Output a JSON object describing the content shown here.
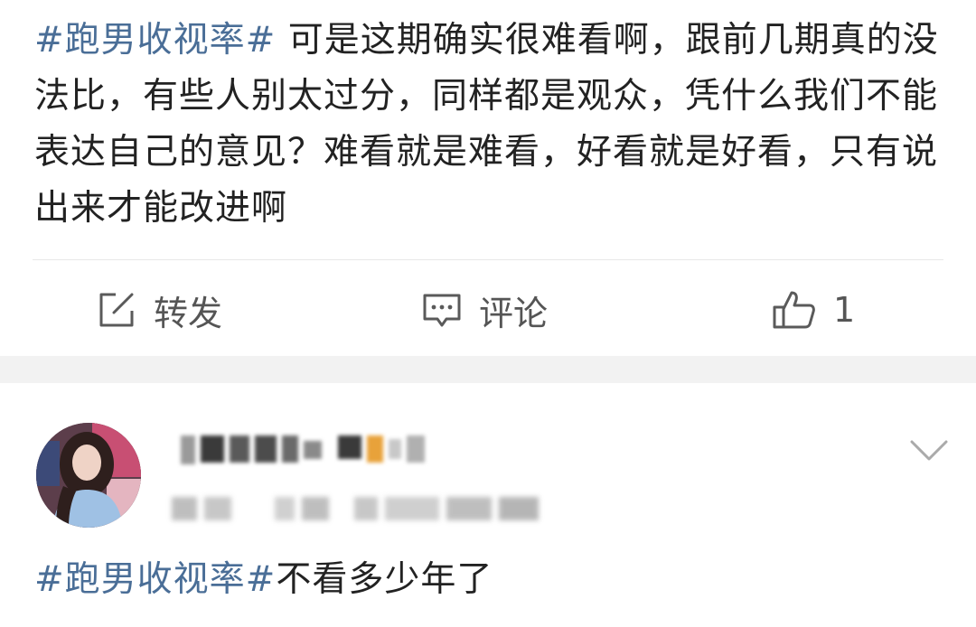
{
  "post1": {
    "hashtag": "#跑男收视率#",
    "body": " 可是这期确实很难看啊，跟前几期真的没法比，有些人别太过分，同样都是观众，凭什么我们不能表达自己的意见？难看就是难看，好看就是好看，只有说出来才能改进啊",
    "actions": {
      "repost": {
        "icon": "share-edit-icon",
        "label": "转发"
      },
      "comment": {
        "icon": "comment-icon",
        "label": "评论"
      },
      "like": {
        "icon": "thumbs-up-icon",
        "count": "1"
      }
    }
  },
  "post2": {
    "hashtag": "#跑男收视率#",
    "body": "不看多少年了",
    "more_icon": "chevron-down-icon",
    "avatar_icon": "avatar"
  },
  "colors": {
    "hashtag": "#4a6e97",
    "text": "#222222",
    "action_gray": "#555555",
    "separator": "#f2f2f2"
  }
}
